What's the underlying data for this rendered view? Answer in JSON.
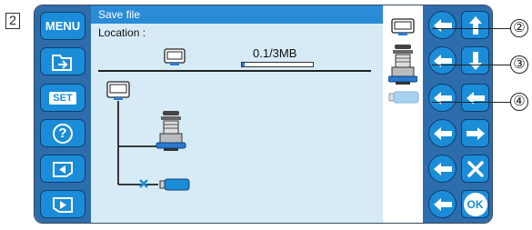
{
  "step_number": "2",
  "left_menu": {
    "menu_label": "MENU",
    "set_label": "SET",
    "help_label": "?"
  },
  "header": {
    "title": "Save file"
  },
  "location_label": "Location :",
  "memory_usage": {
    "text": "0.1/3MB",
    "fraction_used": 0.033
  },
  "right_menu": {
    "ok_label": "OK"
  },
  "callouts": {
    "c2": "②",
    "c3": "③",
    "c4": "④"
  },
  "colors": {
    "bar_blue": "#2d6dab",
    "button_blue": "#1b8dd8",
    "header_blue": "#2a8bd6",
    "panel_bg": "#d7ebf6"
  }
}
